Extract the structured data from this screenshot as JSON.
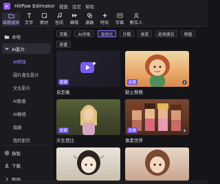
{
  "app": {
    "title": "HitPaw Edimakor"
  },
  "menu": [
    "檔案",
    "設定",
    "幫助"
  ],
  "toolbar": [
    {
      "label": "媒體檔案",
      "icon": "media-folder-icon",
      "active": true
    },
    {
      "label": "文字",
      "icon": "text-icon"
    },
    {
      "label": "素材",
      "icon": "sticker-icon"
    },
    {
      "label": "音訊",
      "icon": "music-icon"
    },
    {
      "label": "轉場",
      "icon": "transition-icon"
    },
    {
      "label": "濾鏡",
      "icon": "filter-icon"
    },
    {
      "label": "特效",
      "icon": "sparkle-icon"
    },
    {
      "label": "字幕",
      "icon": "subtitle-icon"
    },
    {
      "label": "數位人",
      "icon": "avatar-icon"
    }
  ],
  "sidebar": {
    "local": "本地",
    "ai_image": "AI影片",
    "subs": [
      "AI特效",
      "圖片產生影片",
      "文生影片",
      "AI動畫",
      "AI轉場",
      "換臉",
      "我的創作"
    ],
    "record": "錄製",
    "download": "下載",
    "bottom": "範例"
  },
  "chips": [
    "耳動",
    "AI肖眼",
    "風格化",
    "外觀",
    "搞笑",
    "經典廣告",
    "萌寵",
    "節慶"
  ],
  "cards": [
    {
      "label": "自定義",
      "tag": "創建"
    },
    {
      "label": "黏土態態",
      "tag": "創建"
    },
    {
      "label": "天生芭比",
      "tag": "創建"
    },
    {
      "label": "像素世界",
      "tag": "創建"
    },
    {
      "label": "",
      "tag": ""
    },
    {
      "label": "",
      "tag": ""
    }
  ],
  "colors": {
    "accent": "#8c76ff",
    "tag": "#6c4ee6"
  }
}
